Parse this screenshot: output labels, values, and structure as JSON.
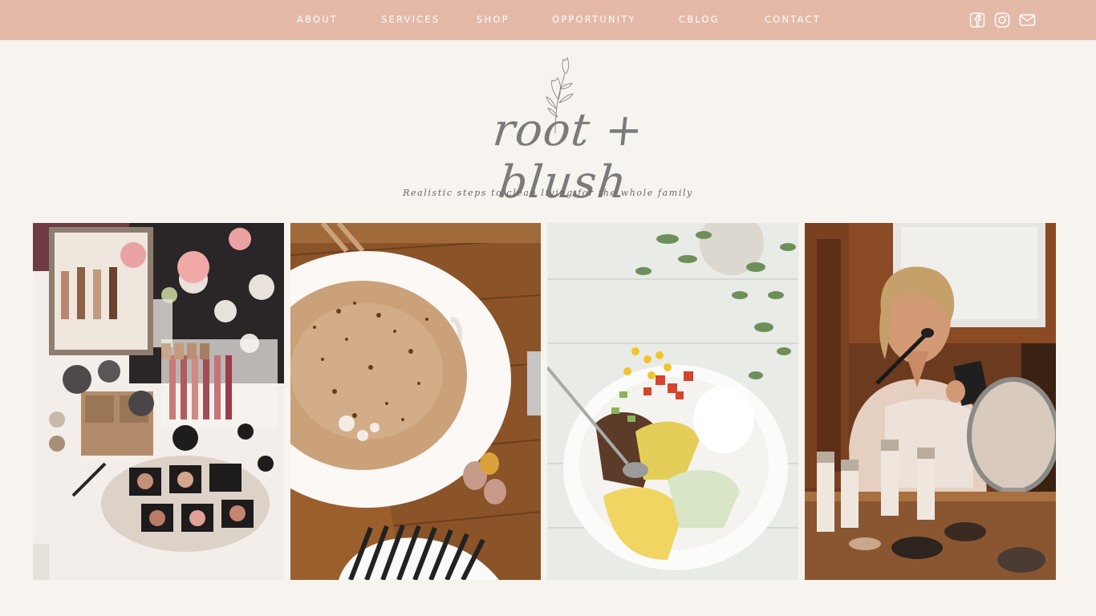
{
  "nav": {
    "items": [
      {
        "label": "ABOUT"
      },
      {
        "label": "SERVICES"
      },
      {
        "label": "SHOP"
      },
      {
        "label": "OPPORTUNITY"
      },
      {
        "label": "CBLOG"
      },
      {
        "label": "CONTACT"
      }
    ],
    "social": [
      "facebook-icon",
      "instagram-icon",
      "email-icon"
    ]
  },
  "brand": {
    "logo_text": "root + blush",
    "tagline": "Realistic steps to clean living for the whole family"
  },
  "gallery": {
    "tiles": [
      "makeup-flatlay-photo",
      "coffee-cup-photo",
      "burrito-bowl-photo",
      "woman-applying-makeup-photo"
    ]
  },
  "colors": {
    "topbar": "#e5b9a8",
    "background": "#f7f3ef",
    "logo": "#7b7a7c"
  }
}
